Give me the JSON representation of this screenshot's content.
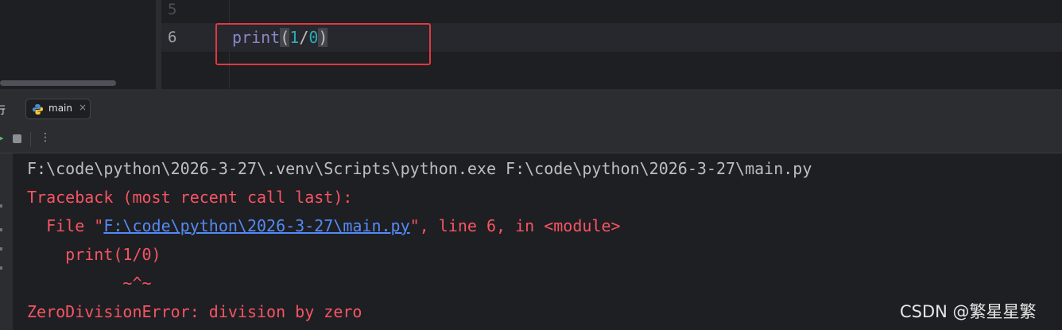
{
  "editor": {
    "lines": [
      {
        "number": "5",
        "code": ""
      },
      {
        "number": "6",
        "code": "print(1/0)"
      }
    ],
    "code_tokens": {
      "fn": "print",
      "open": "(",
      "num1": "1",
      "op": "/",
      "num2": "0",
      "close": ")"
    }
  },
  "run_window": {
    "title": "行",
    "tab": {
      "label": "main",
      "close": "×",
      "icon": "python-icon"
    },
    "toolbar": {
      "more": "⋮"
    }
  },
  "console": {
    "command": "F:\\code\\python\\2026-3-27\\.venv\\Scripts\\python.exe F:\\code\\python\\2026-3-27\\main.py",
    "traceback_header": "Traceback (most recent call last):",
    "file_prefix": "  File \"",
    "file_link": "F:\\code\\python\\2026-3-27\\main.py",
    "file_suffix": "\", line 6, in <module>",
    "source_line": "    print(1/0)",
    "caret_line": "          ~^~",
    "error": "ZeroDivisionError: division by zero"
  },
  "watermark": "CSDN @繁星星繁",
  "colors": {
    "background": "#1e1f22",
    "error_text": "#f75464",
    "link": "#548af7",
    "highlight_box": "#e0393e"
  }
}
